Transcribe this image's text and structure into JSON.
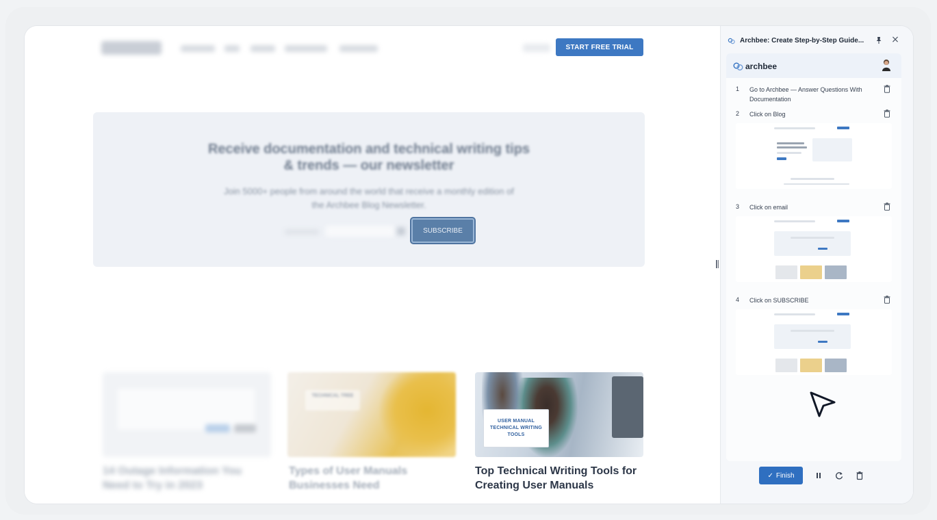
{
  "website": {
    "start_trial_label": "START FREE TRIAL",
    "hero_title_line1": "Receive documentation and technical writing tips",
    "hero_title_line2": "& trends — our newsletter",
    "hero_sub_line1": "Join 5000+ people from around the world that receive a monthly edition of",
    "hero_sub_line2": "the Archbee Blog Newsletter.",
    "subscribe_label": "SUBSCRIBE",
    "cards": [
      {
        "title": "14 Outage Information You Need to Try in 2023",
        "image_tag": ""
      },
      {
        "title": "Types of User Manuals Businesses Need",
        "image_tag": "TECHNICAL TREE"
      },
      {
        "title": "Top Technical Writing Tools for Creating User Manuals",
        "image_tag": "USER MANUAL TECHNICAL WRITING TOOLS"
      }
    ]
  },
  "extension": {
    "title": "Archbee: Create Step-by-Step Guide...",
    "brand_name": "archbee",
    "steps": [
      {
        "num": "1",
        "text": "Go to Archbee — Answer Questions With Documentation"
      },
      {
        "num": "2",
        "text": "Click on Blog"
      },
      {
        "num": "3",
        "text": "Click on email"
      },
      {
        "num": "4",
        "text": "Click on SUBSCRIBE"
      }
    ],
    "finish_label": "Finish",
    "colors": {
      "accent": "#2f6fc0",
      "panel_bg": "#f5f7fa",
      "brand_bar": "#edf2f9"
    }
  }
}
